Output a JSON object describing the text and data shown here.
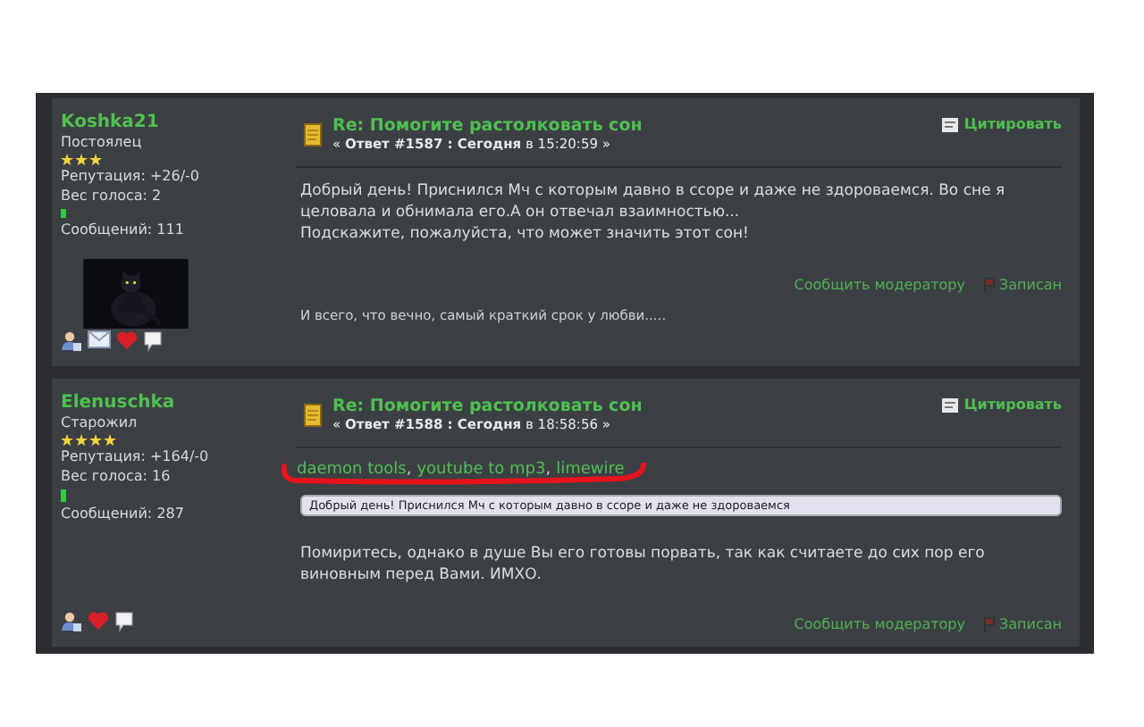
{
  "posts": [
    {
      "author": "Koshka21",
      "rank": "Постоялец",
      "stars": 3,
      "reputation": "Репутация: +26/-0",
      "votes": "Вес голоса: 2",
      "messages": "Сообщений: 111",
      "avatar": {
        "kind": "picture"
      },
      "icons": [
        {
          "kind": "profile"
        },
        {
          "kind": "email"
        },
        {
          "kind": "heart"
        },
        {
          "kind": "comment"
        }
      ],
      "title": "Re: Помогите растолковать сон",
      "meta": "« **Ответ #1587 : Сегодня** в 15:20:59 »",
      "quote_button": "Цитировать",
      "body": [
        "Добрый день! Приснился Мч с которым давно в ссоре и даже не здороваемся. Во сне я целовала и обнимала его.А он отвечал взаимностью...",
        "Подскажите, пожалуйста, что может значить этот сон!"
      ],
      "report": "Сообщить модератору",
      "status": "Записан",
      "signature": "И всего, что вечно, самый краткий срок у любви....."
    },
    {
      "author": "Elenuschka",
      "rank": "Старожил",
      "stars": 4,
      "reputation": "Репутация: +164/-0",
      "votes": "Вес голоса: 16",
      "messages": "Сообщений: 287",
      "icons": [
        {
          "kind": "profile"
        },
        {
          "kind": "heart"
        },
        {
          "kind": "comment"
        }
      ],
      "title": "Re: Помогите растолковать сон",
      "meta": "« **Ответ #1588 : Сегодня** в 18:58:56 »",
      "quote_button": "Цитировать",
      "links": [
        "daemon tools",
        "youtube to mp3",
        "limewire"
      ],
      "link_separator": ",",
      "quote": "Добрый день! Приснился Мч с которым давно в ссоре и даже не здороваемся",
      "body": [
        "Помиритесь, однако в душе Вы его готовы порвать, так как считаете до сих пор его виновным перед Вами. ИМХО."
      ],
      "report": "Сообщить модератору",
      "status": "Записан"
    }
  ]
}
